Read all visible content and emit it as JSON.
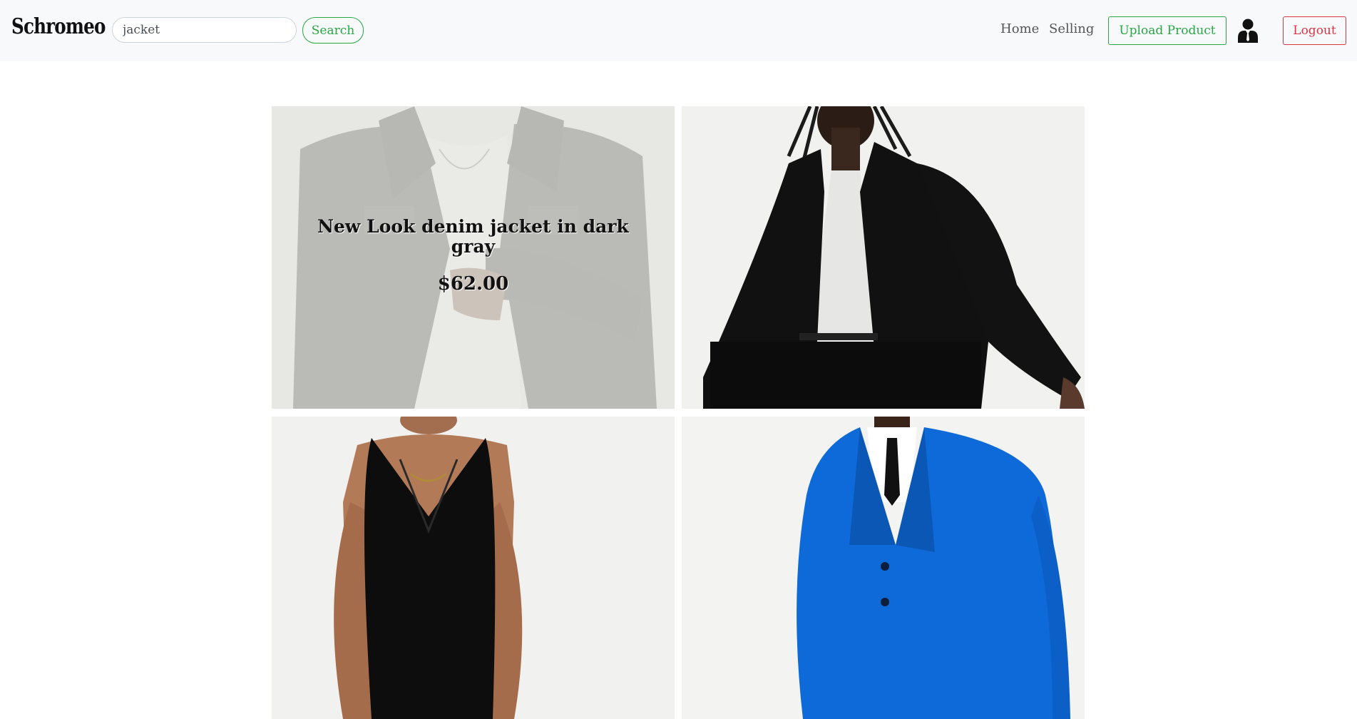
{
  "brand": "Schromeo",
  "search": {
    "value": "jacket",
    "button_label": "Search"
  },
  "nav": {
    "home": "Home",
    "selling": "Selling",
    "upload": "Upload Product",
    "logout": "Logout"
  },
  "icons": {
    "user": "user-avatar-icon"
  },
  "colors": {
    "success": "#28a745",
    "danger": "#dc3545",
    "navbar_bg": "#f8f9fa"
  },
  "products": [
    {
      "title": "New Look denim jacket in dark gray",
      "price": "$62.00"
    }
  ]
}
